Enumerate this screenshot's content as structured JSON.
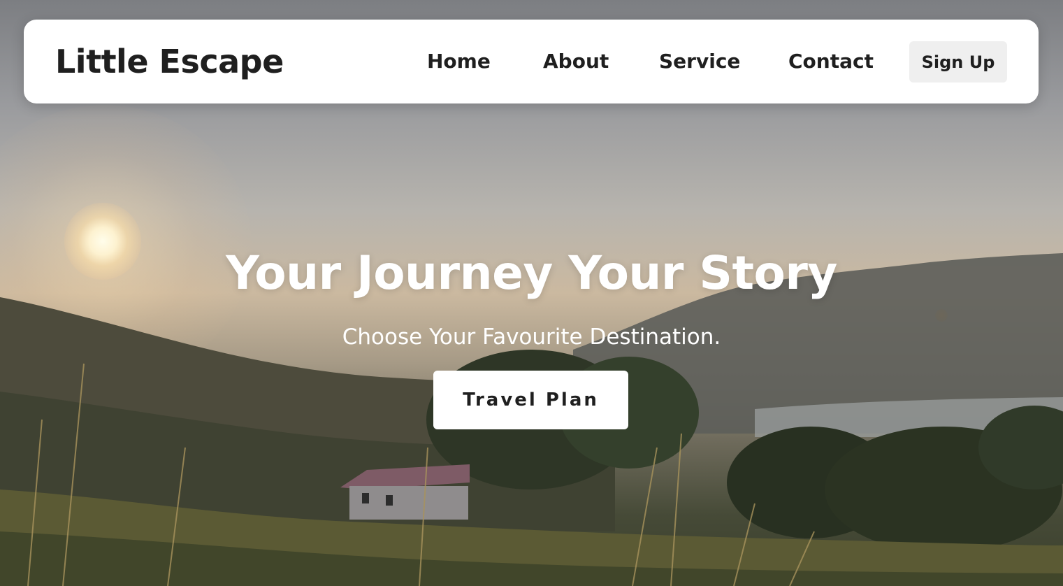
{
  "brand": {
    "name": "Little Escape"
  },
  "nav": {
    "items": [
      {
        "label": "Home"
      },
      {
        "label": "About"
      },
      {
        "label": "Service"
      },
      {
        "label": "Contact"
      }
    ],
    "signup_label": "Sign Up"
  },
  "hero": {
    "title": "Your Journey Your Story",
    "subtitle": "Choose Your Favourite Destination.",
    "cta_label": "Travel Plan"
  },
  "colors": {
    "navbar_bg": "#ffffff",
    "text_dark": "#1f1f1f",
    "signup_bg": "#efefef",
    "hero_text": "#ffffff"
  }
}
